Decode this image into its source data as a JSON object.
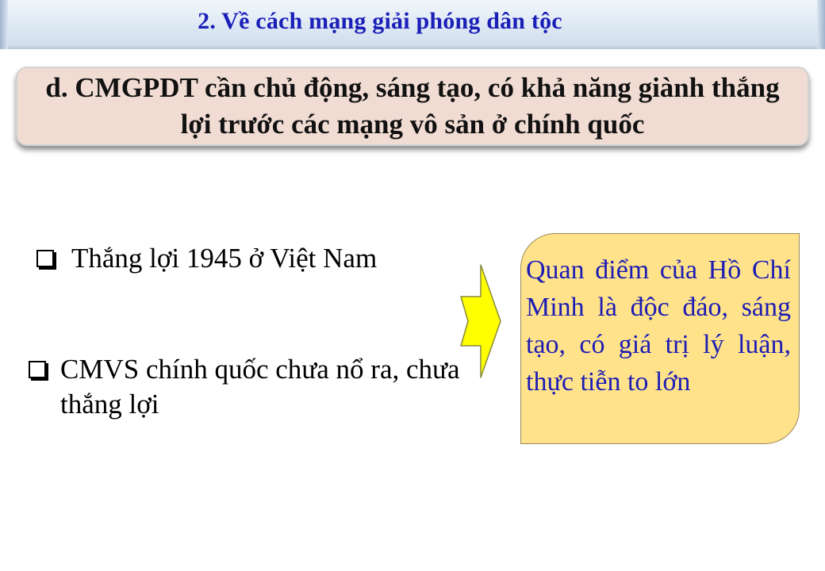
{
  "header": {
    "title": "2. Về cách mạng giải phóng dân tộc"
  },
  "subtitle": {
    "text": "d. CMGPDT cần chủ động, sáng tạo, có khả năng giành thắng lợi trước các mạng vô sản ở chính quốc"
  },
  "bullets": [
    {
      "text": "Thắng lợi 1945 ở Việt Nam",
      "icon": "checkbox-icon"
    },
    {
      "text": "CMVS chính quốc chưa nổ ra, chưa thắng lợi",
      "icon": "checkbox-icon"
    }
  ],
  "arrow": {
    "icon": "right-arrow-icon",
    "fill": "#ffff00"
  },
  "note": {
    "text": "Quan điểm của Hồ Chí Minh là độc đáo, sáng tạo, có giá trị lý luận, thực tiễn to lớn"
  },
  "colors": {
    "title": "#1a1fb8",
    "subtitle_background": "#f1dcd3",
    "note_background": "#ffe28a",
    "note_text": "#1c1cb5"
  }
}
